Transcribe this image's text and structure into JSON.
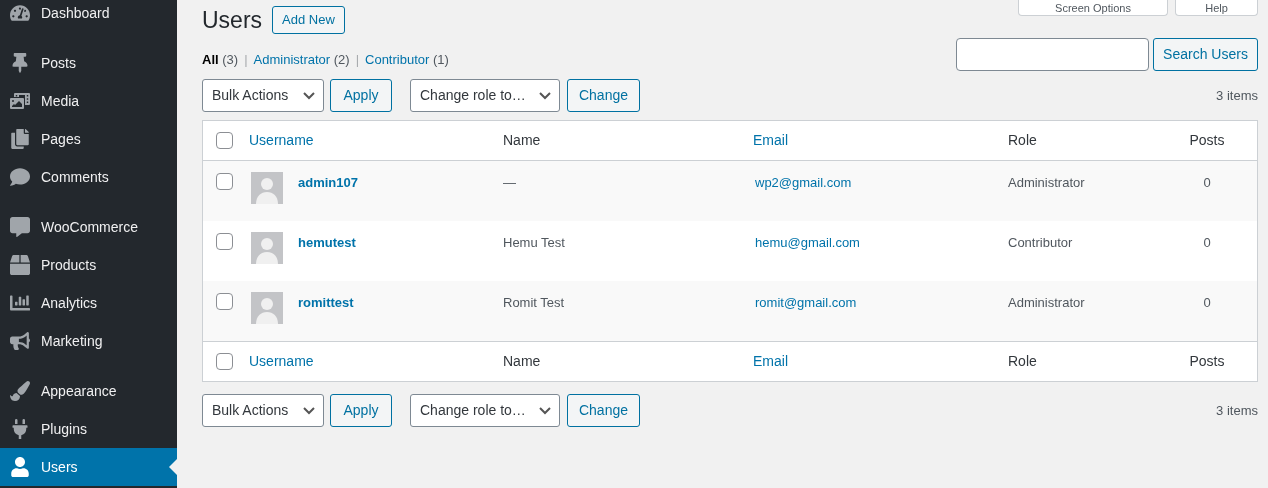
{
  "sidebar": {
    "groups": [
      [
        {
          "label": "Dashboard",
          "selected": false
        }
      ],
      [
        {
          "label": "Posts",
          "selected": false
        },
        {
          "label": "Media",
          "selected": false
        },
        {
          "label": "Pages",
          "selected": false
        },
        {
          "label": "Comments",
          "selected": false
        }
      ],
      [
        {
          "label": "WooCommerce",
          "selected": false
        },
        {
          "label": "Products",
          "selected": false
        },
        {
          "label": "Analytics",
          "selected": false
        },
        {
          "label": "Marketing",
          "selected": false
        }
      ],
      [
        {
          "label": "Appearance",
          "selected": false
        },
        {
          "label": "Plugins",
          "selected": false
        },
        {
          "label": "Users",
          "selected": true
        }
      ]
    ]
  },
  "top_tabs": [
    "Screen Options",
    "Help"
  ],
  "page": {
    "title": "Users",
    "add_button": "Add New"
  },
  "filters": [
    {
      "label": "All",
      "count": "(3)",
      "selected": true
    },
    {
      "separator": "|",
      "label": "Administrator",
      "count": "(2)",
      "selected": false
    },
    {
      "separator": "|",
      "label": "Contributor",
      "count": "(1)",
      "selected": false
    }
  ],
  "search": {
    "button": "Search Users"
  },
  "tablenav_top": {
    "bulk": "Bulk Actions",
    "apply": "Apply",
    "role": "Change role to…",
    "change": "Change",
    "count": "3 items"
  },
  "table": {
    "select_all_checked": false,
    "columns": [
      {
        "label": "Username",
        "sortable": true
      },
      {
        "label": "Name",
        "sortable": false
      },
      {
        "label": "Email",
        "sortable": true
      },
      {
        "label": "Role",
        "sortable": false
      },
      {
        "label": "Posts",
        "sortable": false
      }
    ],
    "rows": [
      {
        "username": "admin107",
        "name": "—",
        "email": "wp2@gmail.com",
        "role": "Administrator",
        "posts": "0",
        "checked": false
      },
      {
        "username": "hemutest",
        "name": "Hemu Test",
        "email": "hemu@gmail.com",
        "role": "Contributor",
        "posts": "0",
        "checked": false
      },
      {
        "username": "romittest",
        "name": "Romit Test",
        "email": "romit@gmail.com",
        "role": "Administrator",
        "posts": "0",
        "checked": false
      }
    ],
    "footer_select_all_checked": false,
    "footer_columns": [
      {
        "label": "Username",
        "sortable": true
      },
      {
        "label": "Name",
        "sortable": false
      },
      {
        "label": "Email",
        "sortable": true
      },
      {
        "label": "Role",
        "sortable": false
      },
      {
        "label": "Posts",
        "sortable": false
      }
    ]
  },
  "tablenav_bottom": {
    "bulk": "Bulk Actions",
    "apply": "Apply",
    "role": "Change role to…",
    "change": "Change",
    "count": "3 items"
  }
}
